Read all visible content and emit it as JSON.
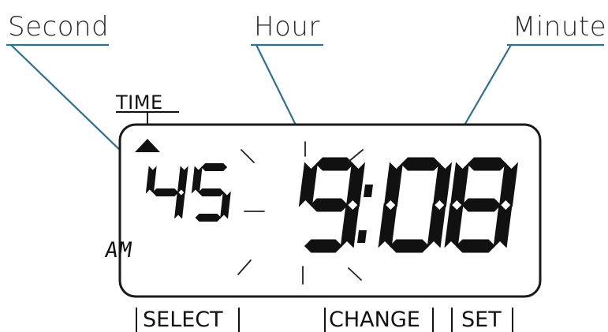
{
  "callouts": {
    "second": "Second",
    "hour": "Hour",
    "minute": "Minute"
  },
  "mode": {
    "label": "TIME",
    "pointer_icon": "triangle-up-icon"
  },
  "display": {
    "seconds": "45",
    "hour": "9",
    "separator": ":",
    "minutes": "08",
    "meridiem": "AM",
    "hour_flashing": true
  },
  "buttons": {
    "select": "SELECT",
    "change": "CHANGE",
    "set": "SET"
  }
}
